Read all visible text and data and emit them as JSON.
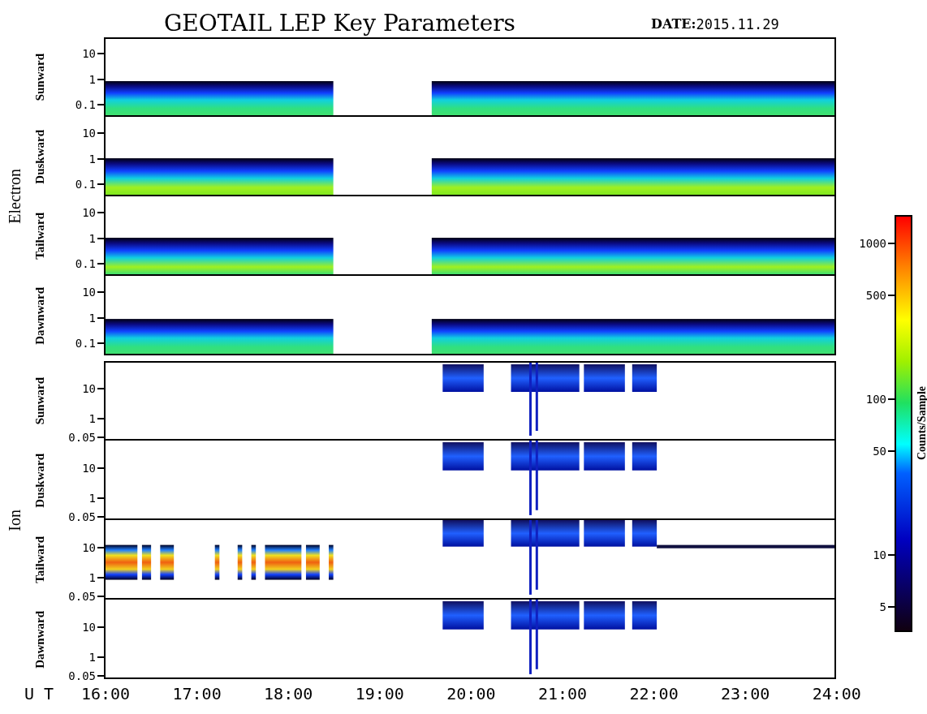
{
  "title": "GEOTAIL LEP Key Parameters",
  "date": {
    "label": "DATE:",
    "value": "2015.11.29"
  },
  "groups": [
    {
      "name": "Electron",
      "kind": "electron",
      "panels": [
        {
          "label": "Sunward",
          "ticks": [
            "10",
            "1",
            "0.1"
          ]
        },
        {
          "label": "Duskward",
          "ticks": [
            "10",
            "1",
            "0.1"
          ]
        },
        {
          "label": "Tailward",
          "ticks": [
            "10",
            "1",
            "0.1"
          ]
        },
        {
          "label": "Dawnward",
          "ticks": [
            "10",
            "1",
            "0.1"
          ]
        }
      ]
    },
    {
      "name": "Ion",
      "kind": "ion",
      "panels": [
        {
          "label": "Sunward",
          "ticks": [
            "10",
            "1",
            "0.05"
          ]
        },
        {
          "label": "Duskward",
          "ticks": [
            "10",
            "1",
            "0.05"
          ]
        },
        {
          "label": "Tailward",
          "ticks": [
            "10",
            "1",
            "0.05"
          ]
        },
        {
          "label": "Dawnward",
          "ticks": [
            "10",
            "1",
            "0.05"
          ]
        }
      ]
    }
  ],
  "time_axis": {
    "label": "U T",
    "ticks": [
      "16:00",
      "17:00",
      "18:00",
      "19:00",
      "20:00",
      "21:00",
      "22:00",
      "23:00",
      "24:00"
    ]
  },
  "colorbar": {
    "title": "Counts/Sample",
    "ticks": [
      "1000",
      "500",
      "100",
      "50",
      "10",
      "5"
    ]
  }
}
